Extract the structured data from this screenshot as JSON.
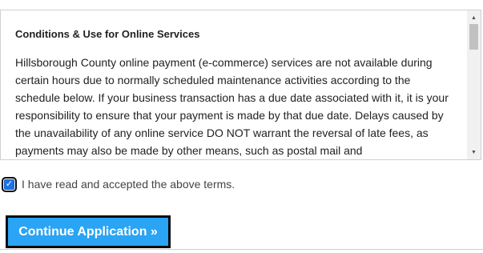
{
  "terms": {
    "title": "Conditions & Use for Online Services",
    "body": "Hillsborough County online payment (e-commerce) services are not available during certain hours due to normally scheduled maintenance activities according to the schedule below. If your business transaction has a due date associated with it, it is your responsibility to ensure that your payment is made by that due date. Delays caused by the unavailability of any online service DO NOT warrant the reversal of late fees, as payments may also be made by other means, such as postal mail and"
  },
  "scrollbar": {
    "up_icon": "triangle-up-icon",
    "down_icon": "triangle-down-icon",
    "up_glyph": "▲",
    "down_glyph": "▼"
  },
  "accept": {
    "checked": true,
    "check_glyph": "✓",
    "label": "I have read and accepted the above terms."
  },
  "actions": {
    "continue_label": "Continue Application »",
    "continue_color": "#2aa4f4"
  }
}
